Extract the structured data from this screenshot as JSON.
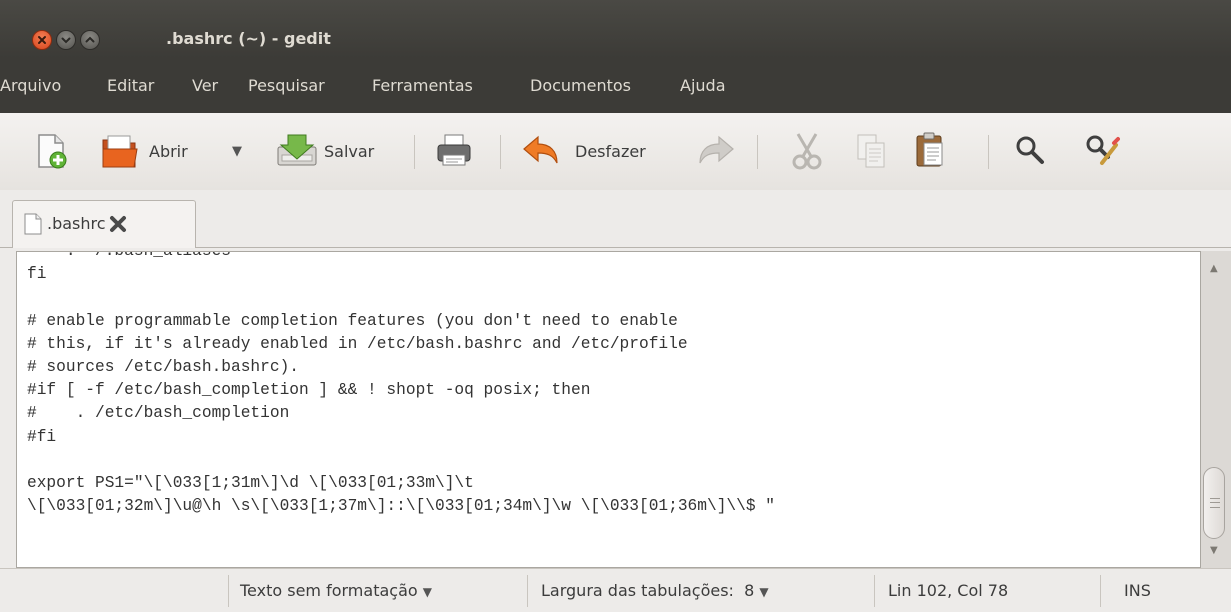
{
  "window": {
    "title": ".bashrc (~) - gedit"
  },
  "menu": [
    "Arquivo",
    "Editar",
    "Ver",
    "Pesquisar",
    "Ferramentas",
    "Documentos",
    "Ajuda"
  ],
  "toolbar": {
    "open_label": "Abrir",
    "save_label": "Salvar",
    "undo_label": "Desfazer"
  },
  "tab": {
    "label": ".bashrc"
  },
  "editor": {
    "lines": [
      "    . ~/.bash_aliases",
      "fi",
      "",
      "# enable programmable completion features (you don't need to enable",
      "# this, if it's already enabled in /etc/bash.bashrc and /etc/profile",
      "# sources /etc/bash.bashrc).",
      "#if [ -f /etc/bash_completion ] && ! shopt -oq posix; then",
      "#    . /etc/bash_completion",
      "#fi",
      "",
      "export PS1=\"\\[\\033[1;31m\\]\\d \\[\\033[01;33m\\]\\t",
      "\\[\\033[01;32m\\]\\u@\\h \\s\\[\\033[1;37m\\]::\\[\\033[01;34m\\]\\w \\[\\033[01;36m\\]\\\\$ \""
    ]
  },
  "status": {
    "language": "Texto sem formatação",
    "tab_width": "Largura das tabulações:  8",
    "position": "Lin 102, Col 78",
    "mode": "INS"
  },
  "colors": {
    "titlebar": "#3c3b37",
    "close_button": "#e9541f",
    "undo_arrow": "#e8741e"
  }
}
